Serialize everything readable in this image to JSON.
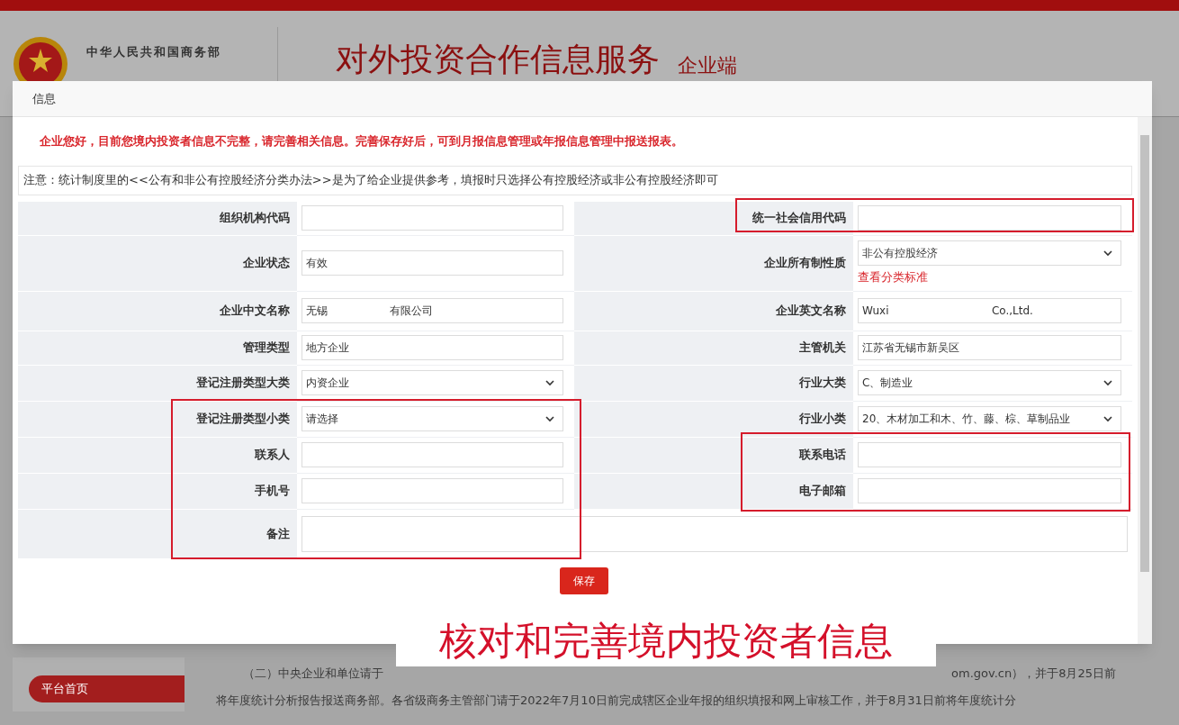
{
  "page_header": {
    "ministry": "中华人民共和国商务部",
    "title": "对外投资合作信息服务",
    "subtitle": "企业端"
  },
  "sidebar": {
    "items": [
      {
        "label": "平台首页",
        "selected": true
      }
    ]
  },
  "notice": {
    "line_1_start": "（二）中央企业和单位请于",
    "line_1_end": "om.gov.cn），并于8月25日前",
    "line_2": "将年度统计分析报告报送商务部。各省级商务主管部门请于2022年7月10日前完成辖区企业年报的组织填报和网上审核工作，并于8月31日前将年度统计分"
  },
  "dialog": {
    "title": "信息",
    "warning": "企业您好，目前您境内投资者信息不完整，请完善相关信息。完善保存好后，可到月报信息管理或年报信息管理中报送报表。",
    "note": "注意：统计制度里的<<公有和非公有控股经济分类办法>>是为了给企业提供参考，填报时只选择公有控股经济或非公有控股经济即可",
    "rows": [
      {
        "left": {
          "label": "组织机构代码",
          "kind": "text"
        },
        "right": {
          "label": "统一社会信用代码",
          "kind": "text"
        }
      },
      {
        "left": {
          "label": "企业状态",
          "kind": "text",
          "value": "有效"
        },
        "right": {
          "label": "企业所有制性质",
          "kind": "select",
          "value": "非公有控股经济",
          "link": "查看分类标准"
        }
      },
      {
        "left": {
          "label": "企业中文名称",
          "kind": "text",
          "value": "无锡                  有限公司"
        },
        "right": {
          "label": "企业英文名称",
          "kind": "text",
          "value": "Wuxi                              Co.,Ltd."
        }
      },
      {
        "left": {
          "label": "管理类型",
          "kind": "text",
          "value": "地方企业"
        },
        "right": {
          "label": "主管机关",
          "kind": "text",
          "value": "江苏省无锡市新吴区"
        }
      },
      {
        "left": {
          "label": "登记注册类型大类",
          "kind": "select",
          "value": "内资企业"
        },
        "right": {
          "label": "行业大类",
          "kind": "select",
          "value": "C、制造业"
        }
      },
      {
        "left": {
          "label": "登记注册类型小类",
          "kind": "select",
          "value": "请选择"
        },
        "right": {
          "label": "行业小类",
          "kind": "select",
          "value": "20、木材加工和木、竹、藤、棕、草制品业"
        }
      },
      {
        "left": {
          "label": "联系人",
          "kind": "text"
        },
        "right": {
          "label": "联系电话",
          "kind": "text"
        }
      },
      {
        "left": {
          "label": "手机号",
          "kind": "text"
        },
        "right": {
          "label": "电子邮箱",
          "kind": "text"
        }
      }
    ],
    "remark": {
      "label": "备注",
      "kind": "textarea"
    },
    "save_button": "保存"
  },
  "caption": "核对和完善境内投资者信息"
}
